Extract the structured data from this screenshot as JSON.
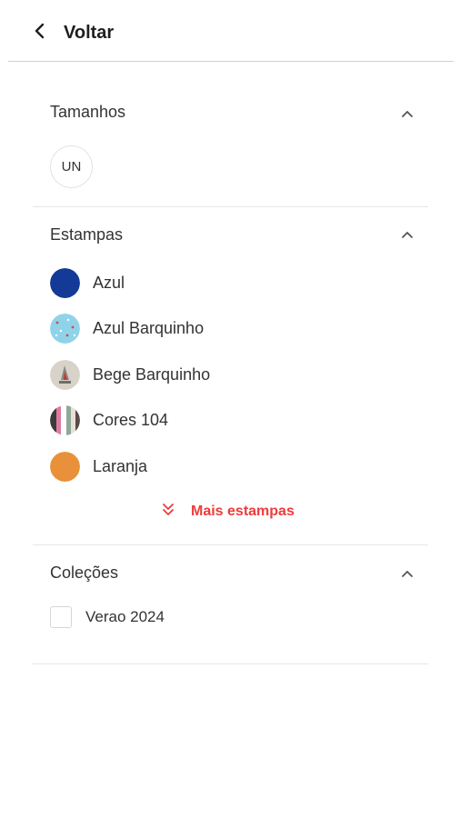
{
  "header": {
    "back_label": "Voltar"
  },
  "sizes": {
    "title": "Tamanhos",
    "options": [
      "UN"
    ]
  },
  "patterns": {
    "title": "Estampas",
    "items": [
      {
        "label": "Azul",
        "color": "#123a96"
      },
      {
        "label": "Azul Barquinho",
        "color": "#8fd3ea"
      },
      {
        "label": "Bege Barquinho",
        "color": "#d8d2c8"
      },
      {
        "label": "Cores 104",
        "color": "#6b6b6b"
      },
      {
        "label": "Laranja",
        "color": "#e8913a"
      }
    ],
    "more_label": "Mais estampas"
  },
  "collections": {
    "title": "Coleções",
    "items": [
      {
        "label": "Verao 2024",
        "checked": false
      }
    ]
  },
  "colors": {
    "accent": "#ef3b3b"
  }
}
